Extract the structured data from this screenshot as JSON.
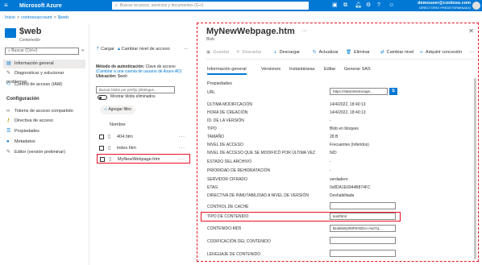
{
  "topbar": {
    "brand": "Microsoft Azure",
    "search_placeholder": "Buscar recursos, servicios y documentos (G+/)",
    "user_email": "demouser@contoso.com",
    "user_directory": "DIRECTORIO PREDETERMINADO"
  },
  "breadcrumb": [
    "Inicio",
    "contosoaccount",
    "$web"
  ],
  "container": {
    "title": "$web",
    "subtitle": "Contenedor",
    "search_placeholder": "Buscar (Ctrl+/)"
  },
  "nav": {
    "items": [
      {
        "label": "Información general",
        "icon": "overview-icon"
      },
      {
        "label": "Diagnosticar y solucionar problemas",
        "icon": "wrench-icon"
      },
      {
        "label": "Control de acceso (IAM)",
        "icon": "people-icon"
      }
    ],
    "section_label": "Configuración",
    "config_items": [
      {
        "label": "Tokens de acceso compartido",
        "icon": "link-icon"
      },
      {
        "label": "Directiva de acceso",
        "icon": "key-icon"
      },
      {
        "label": "Propiedades",
        "icon": "properties-icon"
      },
      {
        "label": "Metadatos",
        "icon": "info-icon"
      },
      {
        "label": "Editor (versión preliminar)",
        "icon": "pencil-icon"
      }
    ]
  },
  "mid": {
    "toolbar": {
      "upload": "Cargar",
      "change_access": "Cambiar nivel de acceso",
      "more": "···"
    },
    "auth_label": "Método de autenticación:",
    "auth_value": "Clave de acceso",
    "auth_link": "(Cambiar a una cuenta de usuario de Azure AD)",
    "location_label": "Ubicación:",
    "location_value": "$web",
    "prefix_placeholder": "Buscar blobs por prefijo (distingue...",
    "show_deleted": "Mostrar blobs eliminados",
    "add_filter": "Agregar filtro",
    "col_name": "Nombre",
    "files": [
      {
        "name": "404.htm",
        "more": "···"
      },
      {
        "name": "index.htm",
        "more": "···"
      },
      {
        "name": "MyNewWebpage.htm",
        "more": "···"
      }
    ]
  },
  "blob": {
    "title": "MyNewWebpage.htm",
    "more": "···",
    "close": "✕",
    "subtitle": "Blob",
    "toolbar": {
      "save": "Guardar",
      "discard": "Descartar",
      "download": "Descargar",
      "refresh": "Actualizar",
      "delete": "Eliminar",
      "change_tier": "Cambiar nivel",
      "acquire_lease": "Adquirir concesión",
      "more": "···"
    },
    "tabs": [
      "Información general",
      "Versiones",
      "Instantáneas",
      "Editar",
      "Generar SAS"
    ],
    "section_title": "Propiedades",
    "url_label": "URL",
    "url_value": "https://staticsitestorage...",
    "props": [
      {
        "label": "ÚLTIMA MODIFICACIÓN",
        "value": "14/4/2022, 18:40:13"
      },
      {
        "label": "HORA DE CREACIÓN",
        "value": "14/4/2022, 18:40:13"
      },
      {
        "label": "ID. DE LA VERSIÓN",
        "value": "-"
      },
      {
        "label": "TIPO",
        "value": "Blob en bloques"
      },
      {
        "label": "TAMAÑO",
        "value": "28 B"
      },
      {
        "label": "NIVEL DE ACCESO",
        "value": "Frecuentes (Inferidos)"
      },
      {
        "label": "NIVEL DE ACCESO QUE SE MODIFICÓ POR ÚLTIMA VEZ",
        "value": "N/D"
      },
      {
        "label": "ESTADO DEL ARCHIVO",
        "value": "-"
      },
      {
        "label": "PRIORIDAD DE REHIDRATACIÓN",
        "value": "-"
      },
      {
        "label": "SERVIDOR CIFRADO",
        "value": "verdadero"
      },
      {
        "label": "ETAG",
        "value": "0x8DA1E6944B874FC"
      },
      {
        "label": "DIRECTIVA DE INMUTABILIDAD A NIVEL DE VERSIÓN",
        "value": "Deshabilitada"
      }
    ],
    "fields": [
      {
        "label": "CONTROL DE CACHÉ",
        "value": ""
      },
      {
        "label": "TIPO DE CONTENIDO",
        "value": "text/html"
      },
      {
        "label": "CONTENIDO-MD5",
        "value": "Bra9bWy0MFErWDo+Aw/Tq..."
      },
      {
        "label": "CODIFICACIÓN DEL CONTENIDO",
        "value": ""
      },
      {
        "label": "LENGUAJE DE CONTENIDO",
        "value": ""
      }
    ]
  }
}
